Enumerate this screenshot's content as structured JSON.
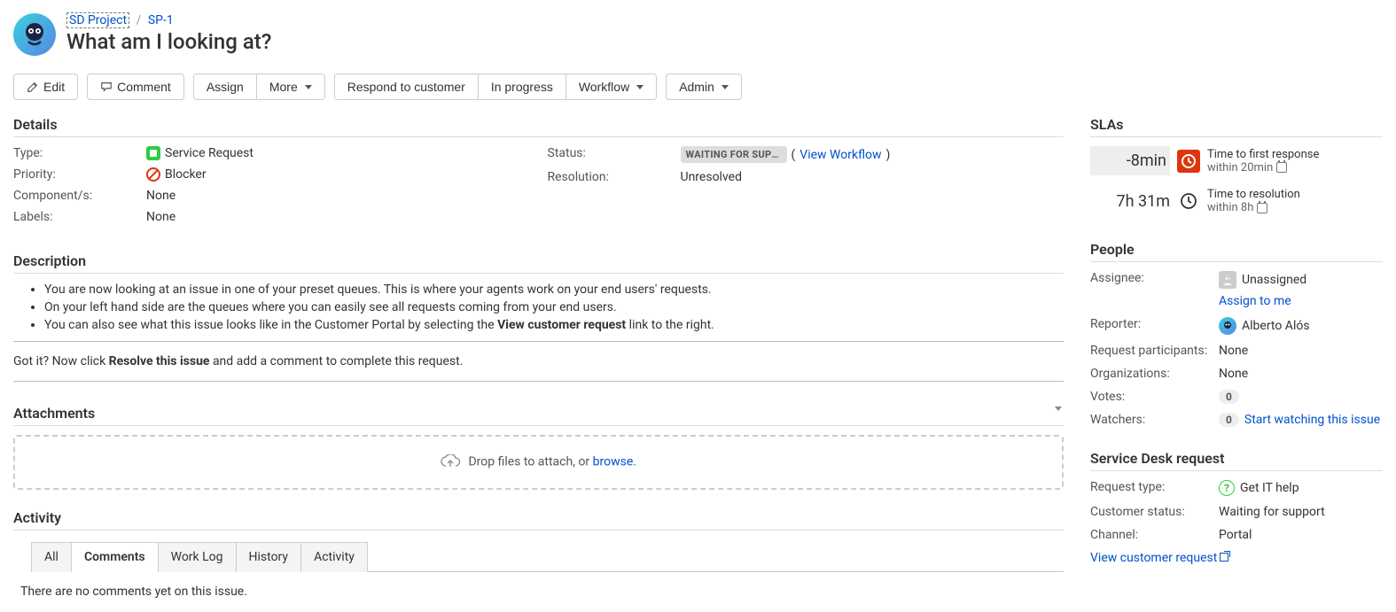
{
  "breadcrumb": {
    "project": "SD Project",
    "key": "SP-1"
  },
  "issue_title": "What am I looking at?",
  "toolbar": {
    "edit": "Edit",
    "comment": "Comment",
    "assign": "Assign",
    "more": "More",
    "respond": "Respond to customer",
    "in_progress": "In progress",
    "workflow": "Workflow",
    "admin": "Admin"
  },
  "sections": {
    "details": "Details",
    "description": "Description",
    "attachments": "Attachments",
    "activity": "Activity",
    "slas": "SLAs",
    "people": "People",
    "service_desk": "Service Desk request"
  },
  "details": {
    "type_label": "Type:",
    "type_value": "Service Request",
    "priority_label": "Priority:",
    "priority_value": "Blocker",
    "components_label": "Component/s:",
    "components_value": "None",
    "labels_label": "Labels:",
    "labels_value": "None",
    "status_label": "Status:",
    "status_value": "WAITING FOR SUPP…",
    "view_workflow": "View Workflow",
    "resolution_label": "Resolution:",
    "resolution_value": "Unresolved"
  },
  "description": {
    "bullet1": "You are now looking at an issue in one of your preset queues. This is where your agents work on your end users' requests.",
    "bullet2": "On your left hand side are the queues where you can easily see all requests coming from your end users.",
    "bullet3_pre": "You can also see what this issue looks like in the Customer Portal by selecting the ",
    "bullet3_bold": "View customer request",
    "bullet3_post": " link to the right.",
    "gotit_pre": "Got it? Now click ",
    "gotit_bold": "Resolve this issue",
    "gotit_post": " and add a comment to complete this request."
  },
  "attachments": {
    "drop_text": "Drop files to attach, or ",
    "browse": "browse",
    "drop_suffix": "."
  },
  "activity": {
    "tabs": {
      "all": "All",
      "comments": "Comments",
      "worklog": "Work Log",
      "history": "History",
      "activity": "Activity"
    },
    "no_comments": "There are no comments yet on this issue."
  },
  "slas": {
    "first_response": {
      "time": "-8min",
      "label": "Time to first response",
      "goal": "within 20min"
    },
    "resolution": {
      "time": "7h 31m",
      "label": "Time to resolution",
      "goal": "within 8h"
    }
  },
  "people": {
    "assignee_label": "Assignee:",
    "assignee_value": "Unassigned",
    "assign_to_me": "Assign to me",
    "reporter_label": "Reporter:",
    "reporter_value": "Alberto Alós",
    "participants_label": "Request participants:",
    "participants_value": "None",
    "orgs_label": "Organizations:",
    "orgs_value": "None",
    "votes_label": "Votes:",
    "votes_count": "0",
    "watchers_label": "Watchers:",
    "watchers_count": "0",
    "start_watching": "Start watching this issue"
  },
  "service_desk": {
    "request_type_label": "Request type:",
    "request_type_value": "Get IT help",
    "customer_status_label": "Customer status:",
    "customer_status_value": "Waiting for support",
    "channel_label": "Channel:",
    "channel_value": "Portal",
    "view_request": "View customer request"
  }
}
